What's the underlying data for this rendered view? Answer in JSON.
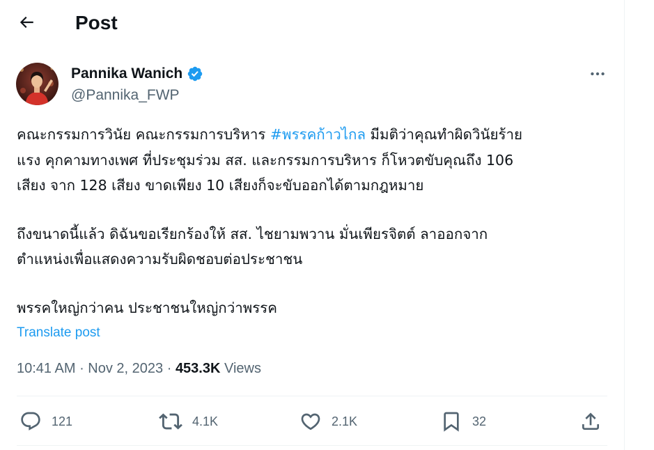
{
  "header": {
    "title": "Post",
    "back_icon": "arrow-left-icon"
  },
  "author": {
    "name": "Pannika Wanich",
    "handle": "@Pannika_FWP",
    "verified_icon": "verified-badge-icon",
    "avatar": "profile-photo"
  },
  "post": {
    "paragraph1_before": "คณะกรรมการวินัย คณะกรรมการบริหาร ",
    "hashtag": "#พรรคก้าวไกล",
    "paragraph1_line1_after": " มีมติว่าคุณทำผิดวินัยร้าย",
    "paragraph1_line2": "แรง คุกคามทางเพศ ที่ประชุมร่วม สส. และกรรมการบริหาร ก็โหวตขับคุณถึง 106",
    "paragraph1_line3": "เสียง จาก 128 เสียง ขาดเพียง 10 เสียงก็จะขับออกได้ตามกฎหมาย",
    "paragraph2_line1": "ถึงขนาดนี้แล้ว ดิฉันขอเรียกร้องให้ สส. ไชยามพวาน มั่นเพียรจิตต์ ลาออกจาก",
    "paragraph2_line2": "ตำแหน่งเพื่อแสดงความรับผิดชอบต่อประชาชน",
    "paragraph3": "พรรคใหญ่กว่าคน ประชาชนใหญ่กว่าพรรค",
    "translate_label": "Translate post"
  },
  "meta": {
    "time": "10:41 AM",
    "separator": " · ",
    "date": "Nov 2, 2023",
    "views_count": "453.3K",
    "views_label": " Views"
  },
  "actions": {
    "replies": "121",
    "reposts": "4.1K",
    "likes": "2.1K",
    "bookmarks": "32"
  },
  "colors": {
    "accent": "#1d9bf0",
    "text_primary": "#0f1419",
    "text_secondary": "#536471",
    "border": "#eff3f4"
  }
}
